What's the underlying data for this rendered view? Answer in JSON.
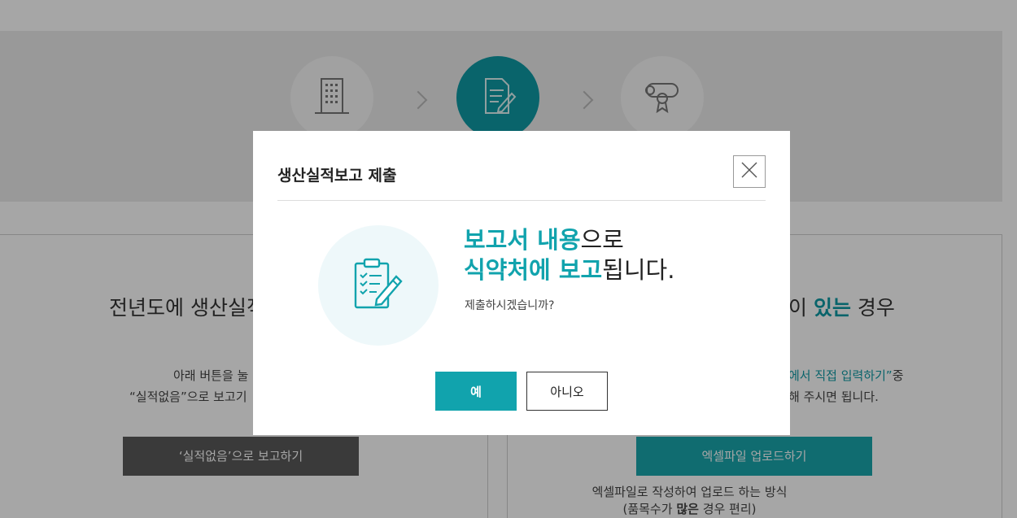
{
  "steps": [
    {
      "icon": "building-icon",
      "active": false
    },
    {
      "icon": "document-edit-icon",
      "active": true
    },
    {
      "icon": "diploma-icon",
      "active": false
    }
  ],
  "left_panel": {
    "heading": "전년도에 생산실적",
    "desc_line1": "아래 버튼을 눌",
    "desc_line2": "“실적없음”으로 보고기",
    "button_label": "‘실적없음’으로 보고하기"
  },
  "right_panel": {
    "heading_prefix": "이 ",
    "heading_accent": "있는",
    "heading_suffix": " 경우",
    "desc_line1_teal": "에서 직접 입력하기”",
    "desc_line1_suffix": "중",
    "desc_line2": "해 주시면 됩니다.",
    "button_label": "엑셀파일 업로드하기",
    "sub_line1": "엑셀파일로 작성하여 업로드 하는 방식",
    "sub_line2_prefix": "(품목수가 ",
    "sub_line2_bold": "많은",
    "sub_line2_suffix": " 경우 편리)"
  },
  "modal": {
    "title": "생산실적보고 제출",
    "line1_accent": "보고서 내용",
    "line1_rest": "으로",
    "line2_accent": "식약처에 보고",
    "line2_rest": "됩니다.",
    "question": "제출하시겠습니까?",
    "yes_label": "예",
    "no_label": "아니오",
    "close_icon": "close-icon",
    "illustration_icon": "clipboard-edit-icon",
    "accent_color": "#11a3ad"
  }
}
